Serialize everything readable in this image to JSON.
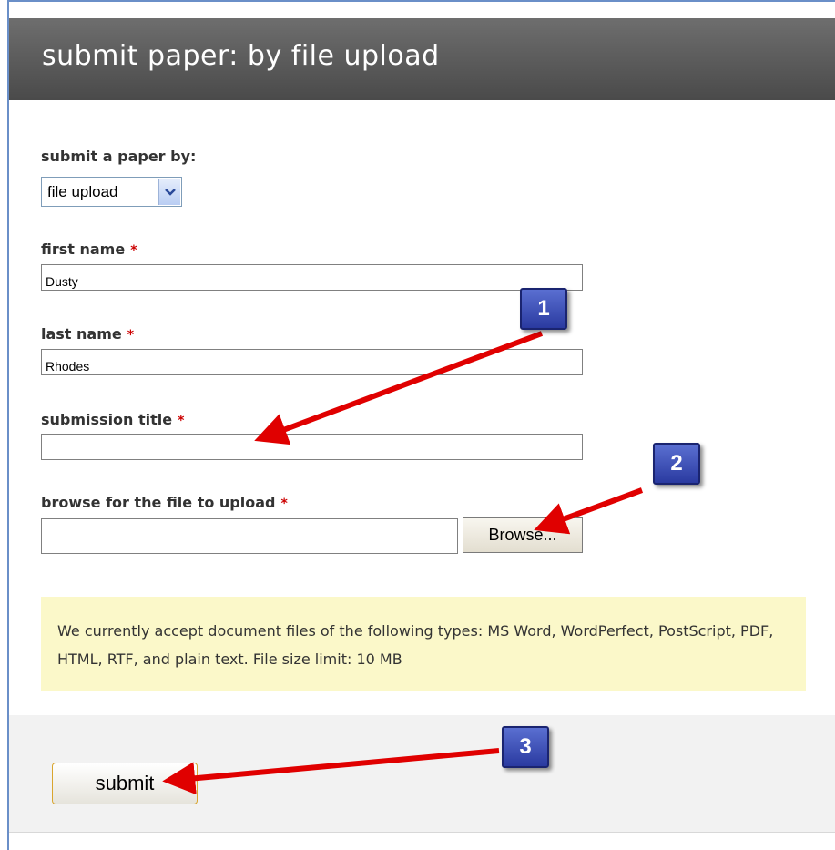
{
  "header": {
    "title": "submit paper: by file upload"
  },
  "form": {
    "method_label": "submit a paper by:",
    "method_value": "file upload",
    "first_name_label": "first name",
    "first_name_value": "Dusty",
    "last_name_label": "last name",
    "last_name_value": "Rhodes",
    "title_label": "submission title",
    "title_value": "",
    "file_label": "browse for the file to upload",
    "file_value": "",
    "browse_label": "Browse...",
    "required_marker": "*"
  },
  "notice": {
    "text": "We currently accept document files of the following types: MS Word, WordPerfect, PostScript, PDF, HTML, RTF, and plain text. File size limit: 10 MB"
  },
  "footer": {
    "submit_label": "submit"
  },
  "callouts": [
    "1",
    "2",
    "3"
  ],
  "colors": {
    "header_bg": "#5a5a5a",
    "required": "#cc0000",
    "notice_bg": "#fbf8c9",
    "arrow": "#e00000",
    "badge": "#3a4db8"
  }
}
